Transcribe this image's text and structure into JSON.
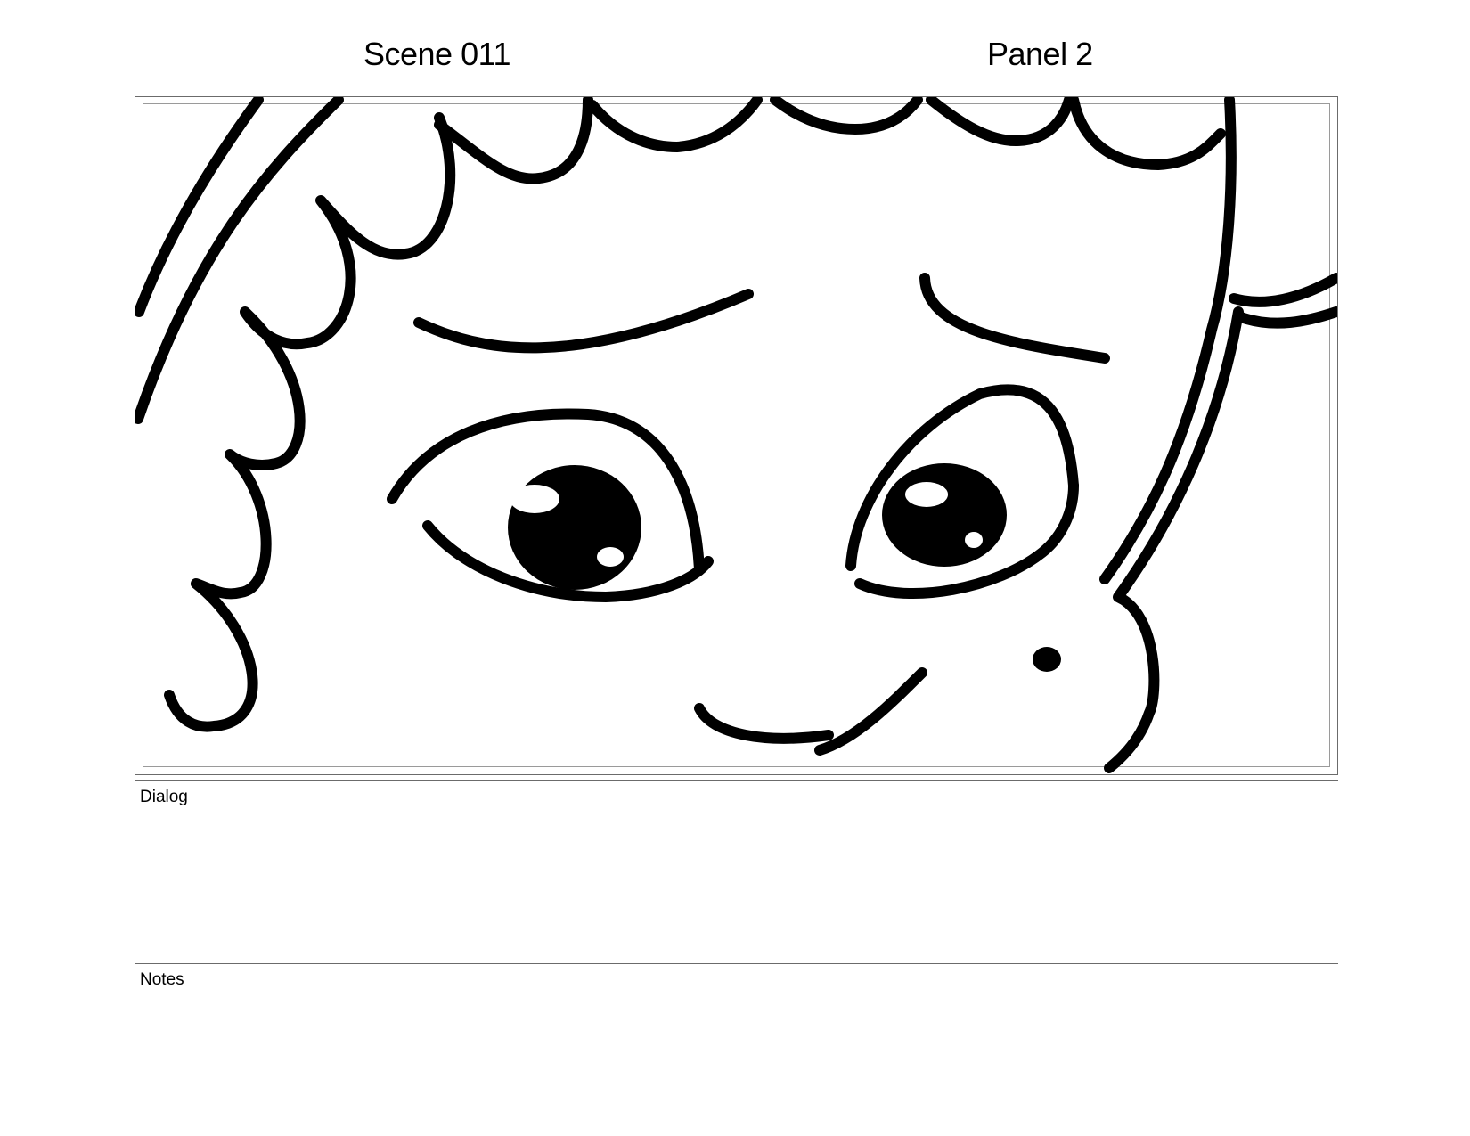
{
  "header": {
    "scene": "Scene 011",
    "panel": "Panel 2"
  },
  "sections": {
    "dialog_label": "Dialog",
    "dialog_text": "",
    "notes_label": "Notes",
    "notes_text": ""
  },
  "colors": {
    "ink": "#000000",
    "paper": "#ffffff",
    "frame": "#6b6b6b"
  }
}
